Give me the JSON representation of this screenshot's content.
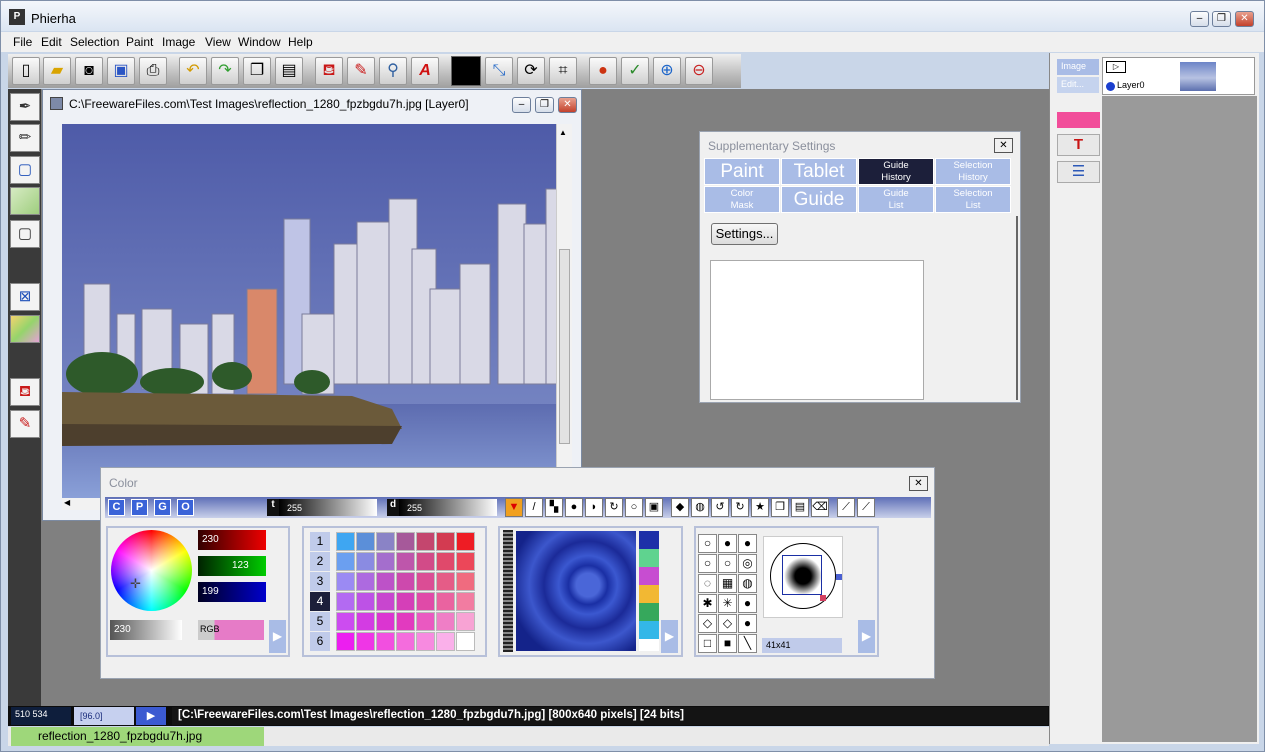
{
  "app": {
    "title": "Phierha",
    "icon_text": "P"
  },
  "menu": [
    "File",
    "Edit",
    "Selection",
    "Paint",
    "Image",
    "View",
    "Window",
    "Help"
  ],
  "image_window": {
    "title": "C:\\FreewareFiles.com\\Test Images\\reflection_1280_fpzbgdu7h.jpg [Layer0]"
  },
  "right_panel": {
    "image_btn": "Image",
    "edit_btn": "Edit...",
    "layer_name": "Layer0"
  },
  "supplementary": {
    "title": "Supplementary Settings",
    "tabs_row1": [
      {
        "lines": [
          "Paint"
        ],
        "size": "big"
      },
      {
        "lines": [
          "Tablet"
        ],
        "size": "big"
      },
      {
        "lines": [
          "Guide",
          "History"
        ],
        "size": "small",
        "active": true
      },
      {
        "lines": [
          "Selection",
          "History"
        ],
        "size": "small"
      }
    ],
    "tabs_row2": [
      {
        "lines": [
          "Color",
          "Mask"
        ],
        "size": "small"
      },
      {
        "lines": [
          "Guide"
        ],
        "size": "big"
      },
      {
        "lines": [
          "Guide",
          "List"
        ],
        "size": "small"
      },
      {
        "lines": [
          "Selection",
          "List"
        ],
        "size": "small"
      }
    ],
    "settings_button": "Settings..."
  },
  "color_window": {
    "title": "Color",
    "mode_buttons": [
      "C",
      "P",
      "G",
      "O"
    ],
    "t_label": "t",
    "t_value": "255",
    "d_label": "d",
    "d_value": "255",
    "r_value": "230",
    "g_value": "123",
    "b_value": "199",
    "gray_value": "230",
    "mode_label": "RGB",
    "row_numbers": [
      "1",
      "2",
      "3",
      "4",
      "5",
      "6"
    ],
    "brush_size": "41x41",
    "swatch_colors": [
      [
        "#3ea6f2",
        "#5b8fd9",
        "#8a83c6",
        "#a6599a",
        "#c4466e",
        "#d33b51",
        "#ee1c24"
      ],
      [
        "#6b9ff0",
        "#8a8be2",
        "#a46ecd",
        "#be56ab",
        "#d24b88",
        "#e0496b",
        "#ec4759"
      ],
      [
        "#9b8af3",
        "#ad6ae0",
        "#bd52c8",
        "#cd49ad",
        "#db4d95",
        "#e55c87",
        "#f06b7f"
      ],
      [
        "#b36af2",
        "#bd52e6",
        "#c846cf",
        "#d53fb8",
        "#e04aa8",
        "#ea63a0",
        "#f27ca1"
      ],
      [
        "#cc4cf0",
        "#d33ce3",
        "#db35d1",
        "#e23abf",
        "#ea59c1",
        "#ef7ec6",
        "#f8a3d4"
      ],
      [
        "#ec1ef0",
        "#ef36e6",
        "#f24fe0",
        "#f46cdd",
        "#f78ae0",
        "#fab0ea",
        "#ffffff"
      ]
    ]
  },
  "status": {
    "coords": "510 534",
    "zoom": "[96.0]",
    "info": "[C:\\FreewareFiles.com\\Test Images\\reflection_1280_fpzbgdu7h.jpg] [800x640 pixels] [24 bits]",
    "filename_tab": "reflection_1280_fpzbgdu7h.jpg"
  }
}
